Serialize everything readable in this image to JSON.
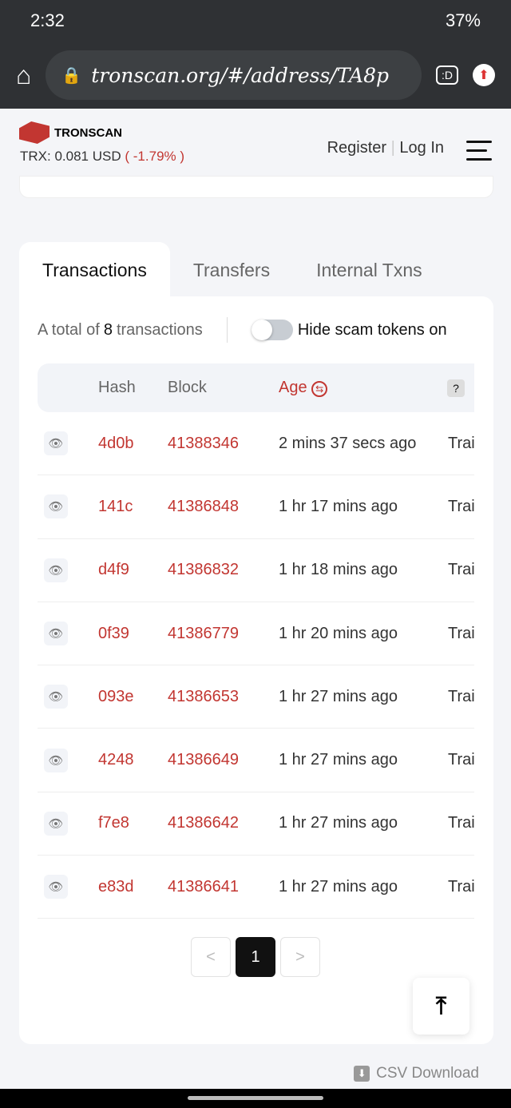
{
  "status": {
    "time": "2:32",
    "battery": "37%"
  },
  "browser": {
    "url": "tronscan.org/#/address/TA8p"
  },
  "header": {
    "brand": "TRONSCAN",
    "price_label": "TRX:",
    "price": "0.081",
    "currency": "USD",
    "change": "( -1.79% )",
    "register": "Register",
    "login": "Log In"
  },
  "tabs": [
    {
      "label": "Transactions"
    },
    {
      "label": "Transfers"
    },
    {
      "label": "Internal Txns"
    }
  ],
  "summary": {
    "prefix": "A total of",
    "count": "8",
    "suffix": "transactions",
    "toggle_label": "Hide scam tokens on",
    "toggle_on": false
  },
  "table": {
    "headers": {
      "hash": "Hash",
      "block": "Block",
      "age": "Age",
      "help": "?"
    },
    "rows": [
      {
        "hash": "4d0b",
        "block": "41388346",
        "age": "2 mins 37 secs ago",
        "type": "Trai"
      },
      {
        "hash": "141c",
        "block": "41386848",
        "age": "1 hr 17 mins ago",
        "type": "Trai"
      },
      {
        "hash": "d4f9",
        "block": "41386832",
        "age": "1 hr 18 mins ago",
        "type": "Trai"
      },
      {
        "hash": "0f39",
        "block": "41386779",
        "age": "1 hr 20 mins ago",
        "type": "Trai"
      },
      {
        "hash": "093e",
        "block": "41386653",
        "age": "1 hr 27 mins ago",
        "type": "Trai"
      },
      {
        "hash": "4248",
        "block": "41386649",
        "age": "1 hr 27 mins ago",
        "type": "Trai"
      },
      {
        "hash": "f7e8",
        "block": "41386642",
        "age": "1 hr 27 mins ago",
        "type": "Trai"
      },
      {
        "hash": "e83d",
        "block": "41386641",
        "age": "1 hr 27 mins ago",
        "type": "Trai"
      }
    ]
  },
  "pagination": {
    "prev": "<",
    "current": "1",
    "next": ">"
  },
  "csv": "CSV Download",
  "colors": {
    "accent": "#c23631"
  }
}
